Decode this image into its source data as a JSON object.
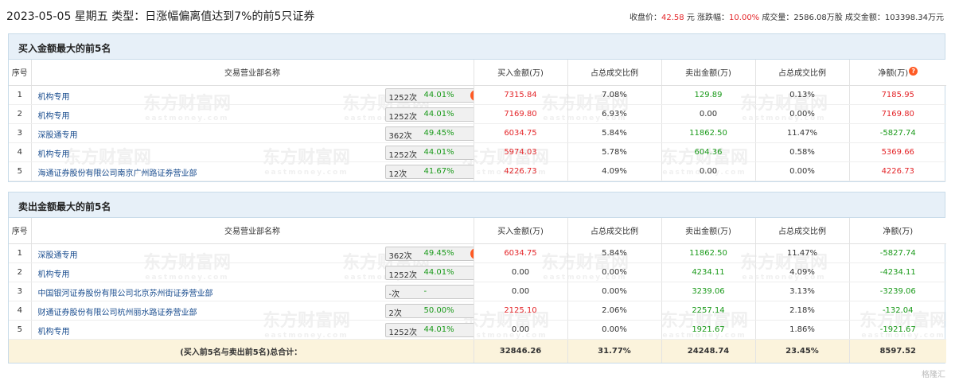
{
  "header": {
    "title": "2023-05-05 星期五 类型：日涨幅偏离值达到7%的前5只证券",
    "close_label": "收盘价：",
    "close_value": "42.58",
    "close_unit": "元",
    "change_label": "涨跌幅：",
    "change_value": "10.00%",
    "volume_label": "成交量：",
    "volume_value": "2586.08万股",
    "turnover_label": "成交金额：",
    "turnover_value": "103398.34万元"
  },
  "columns": [
    "序号",
    "交易营业部名称",
    "买入金额(万)",
    "占总成交比例",
    "卖出金额(万)",
    "占总成交比例",
    "净额(万)"
  ],
  "help_icon": "?",
  "buy_section": {
    "title": "买入金额最大的前5名",
    "rows": [
      {
        "idx": "1",
        "name": "机构专用",
        "count": "1252次",
        "pct": "44.01%",
        "marker": "badge",
        "buy": "7315.84",
        "buy_ratio": "7.08%",
        "sell": "129.89",
        "sell_ratio": "0.13%",
        "net": "7185.95",
        "net_color": "red"
      },
      {
        "idx": "2",
        "name": "机构专用",
        "count": "1252次",
        "pct": "44.01%",
        "marker": "arrow",
        "buy": "7169.80",
        "buy_ratio": "6.93%",
        "sell": "0.00",
        "sell_ratio": "0.00%",
        "net": "7169.80",
        "net_color": "red"
      },
      {
        "idx": "3",
        "name": "深股通专用",
        "count": "362次",
        "pct": "49.45%",
        "marker": "arrow",
        "buy": "6034.75",
        "buy_ratio": "5.84%",
        "sell": "11862.50",
        "sell_ratio": "11.47%",
        "net": "-5827.74",
        "net_color": "green"
      },
      {
        "idx": "4",
        "name": "机构专用",
        "count": "1252次",
        "pct": "44.01%",
        "marker": "arrow",
        "buy": "5974.03",
        "buy_ratio": "5.78%",
        "sell": "604.36",
        "sell_ratio": "0.58%",
        "net": "5369.66",
        "net_color": "red"
      },
      {
        "idx": "5",
        "name": "海通证券股份有限公司南京广州路证券营业部",
        "count": "12次",
        "pct": "41.67%",
        "marker": "arrow",
        "buy": "4226.73",
        "buy_ratio": "4.09%",
        "sell": "0.00",
        "sell_ratio": "0.00%",
        "net": "4226.73",
        "net_color": "red"
      }
    ]
  },
  "sell_section": {
    "title": "卖出金额最大的前5名",
    "rows": [
      {
        "idx": "1",
        "name": "深股通专用",
        "count": "362次",
        "pct": "49.45%",
        "marker": "badge",
        "buy": "6034.75",
        "buy_ratio": "5.84%",
        "sell": "11862.50",
        "sell_ratio": "11.47%",
        "net": "-5827.74",
        "net_color": "green"
      },
      {
        "idx": "2",
        "name": "机构专用",
        "count": "1252次",
        "pct": "44.01%",
        "marker": "arrow",
        "buy": "0.00",
        "buy_ratio": "0.00%",
        "sell": "4234.11",
        "sell_ratio": "4.09%",
        "net": "-4234.11",
        "net_color": "green"
      },
      {
        "idx": "3",
        "name": "中国银河证券股份有限公司北京苏州街证券营业部",
        "count": "-次",
        "pct": "-",
        "marker": "arrow",
        "buy": "0.00",
        "buy_ratio": "0.00%",
        "sell": "3239.06",
        "sell_ratio": "3.13%",
        "net": "-3239.06",
        "net_color": "green"
      },
      {
        "idx": "4",
        "name": "财通证券股份有限公司杭州丽水路证券营业部",
        "count": "2次",
        "pct": "50.00%",
        "marker": "arrow",
        "buy": "2125.10",
        "buy_ratio": "2.06%",
        "sell": "2257.14",
        "sell_ratio": "2.18%",
        "net": "-132.04",
        "net_color": "green"
      },
      {
        "idx": "5",
        "name": "机构专用",
        "count": "1252次",
        "pct": "44.01%",
        "marker": "arrow",
        "buy": "0.00",
        "buy_ratio": "0.00%",
        "sell": "1921.67",
        "sell_ratio": "1.86%",
        "net": "-1921.67",
        "net_color": "green"
      }
    ]
  },
  "total": {
    "label": "(买入前5名与卖出前5名)总合计：",
    "buy": "32846.26",
    "buy_ratio": "31.77%",
    "sell": "24248.74",
    "sell_ratio": "23.45%",
    "net": "8597.52"
  },
  "watermark": {
    "cn": "东方财富网",
    "en": "eastmoney.com"
  },
  "corner_logo": "格隆汇",
  "colors": {
    "up": "#e4262a",
    "down": "#1a9a1a",
    "link": "#1a4d8f",
    "section_bg": "#e7f0f8",
    "total_bg": "#fbf3dc",
    "badge": "#ff5a24"
  }
}
